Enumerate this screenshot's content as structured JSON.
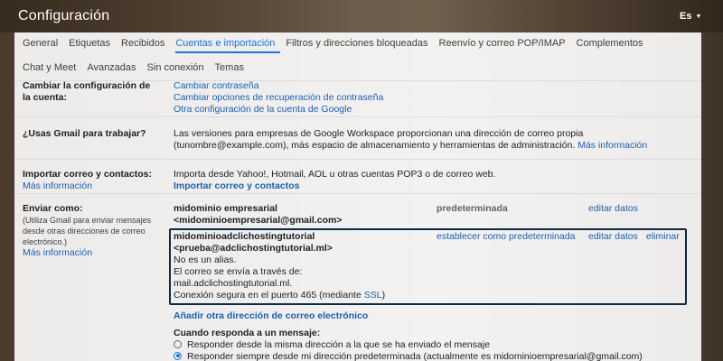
{
  "app": {
    "title": "Configuración",
    "language": "Es"
  },
  "tabs_row1": [
    "General",
    "Etiquetas",
    "Recibidos",
    "Cuentas e importación",
    "Filtros y direcciones bloqueadas",
    "Reenvío y correo POP/IMAP",
    "Complementos"
  ],
  "tabs_row2": [
    "Chat y Meet",
    "Avanzadas",
    "Sin conexión",
    "Temas"
  ],
  "active_tab": "Cuentas e importación",
  "account_settings": {
    "label": "Cambiar la configuración de la cuenta:",
    "links": [
      "Cambiar contraseña",
      "Cambiar opciones de recuperación de contraseña",
      "Otra configuración de la cuenta de Google"
    ]
  },
  "workspace": {
    "label": "¿Usas Gmail para trabajar?",
    "text_line1": "Las versiones para empresas de Google Workspace proporcionan una dirección de correo propia",
    "text_line2": "(tunombre@example.com), más espacio de almacenamiento y herramientas de administración.",
    "more_link": "Más información"
  },
  "import": {
    "label": "Importar correo y contactos:",
    "more_link": "Más información",
    "text": "Importa desde Yahoo!, Hotmail, AOL u otras cuentas POP3 o de correo web.",
    "action_link": "Importar correo y contactos"
  },
  "send_as": {
    "label": "Enviar como:",
    "help_line1": "(Utiliza Gmail para enviar mensajes",
    "help_line2": "desde otras direcciones de correo",
    "help_line3": "electrónico.)",
    "more_link": "Más información",
    "accounts": [
      {
        "name": "midominio empresarial",
        "email": "<midominioempresarial@gmail.com>",
        "status": "predeterminada",
        "edit": "editar datos"
      },
      {
        "name": "midominioadclichostingtutorial",
        "email": "<prueba@adclichostingtutorial.ml>",
        "alias_note": "No es un alias.",
        "via_line1": "El correo se envía a través de:",
        "via_line2": "mail.adclichostingtutorial.ml.",
        "secure_prefix": "Conexión segura en el puerto 465 (mediante ",
        "ssl_link": "SSL",
        "secure_suffix": ")",
        "make_default": "establecer como predeterminada",
        "edit": "editar datos",
        "delete": "eliminar"
      }
    ],
    "add_link": "Añadir otra dirección de correo electrónico",
    "reply_heading": "Cuando responda a un mensaje:",
    "reply_options": [
      "Responder desde la misma dirección a la que se ha enviado el mensaje",
      "Responder siempre desde mi dirección predeterminada (actualmente es midominioempresarial@gmail.com)"
    ],
    "reply_selected": 1
  },
  "colors": {
    "accent": "#1a73e8",
    "link": "#1a5fb4",
    "highlight_border": "#0b2a44"
  }
}
